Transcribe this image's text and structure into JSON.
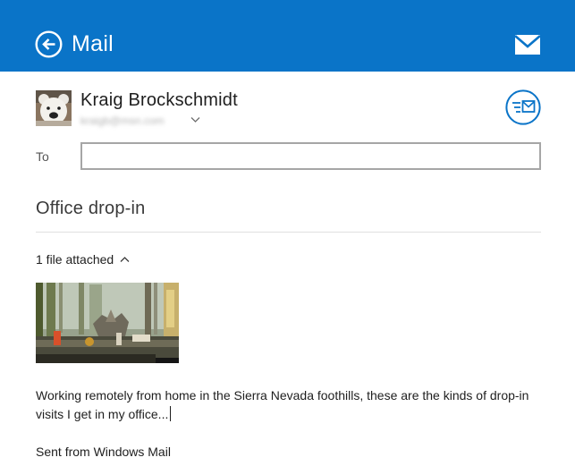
{
  "header": {
    "title": "Mail",
    "back_icon": "back-arrow-circle-icon",
    "send_icon": "envelope-icon",
    "background_color": "#0a74c8"
  },
  "sender": {
    "name": "Kraig Brockschmidt",
    "email": "kraigb@msn.com",
    "avatar_icon": "teddy-bear-avatar"
  },
  "options_icon": "mail-options-icon",
  "to": {
    "label": "To",
    "value": ""
  },
  "subject": "Office drop-in",
  "attachments": {
    "toggle_label": "1 file attached",
    "count": 1
  },
  "body": {
    "text": "Working remotely from home in the Sierra Nevada foothills, these are the kinds of drop-in visits I get in my office...",
    "signature": "Sent from Windows Mail"
  }
}
